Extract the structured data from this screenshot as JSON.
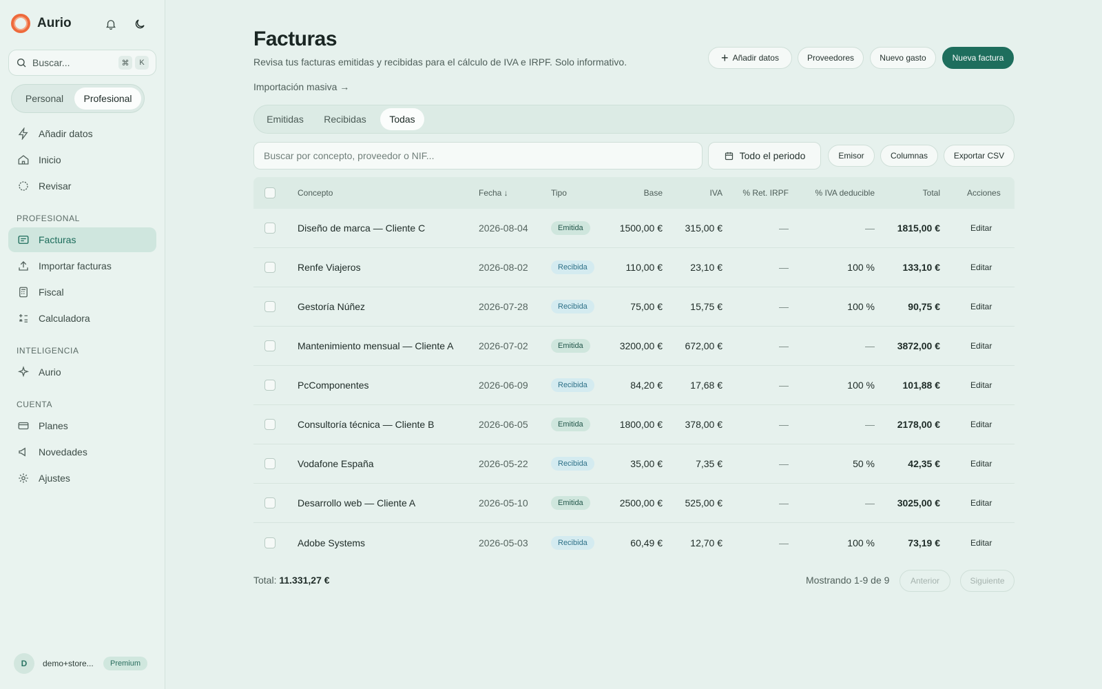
{
  "app": {
    "name": "Aurio"
  },
  "sidebar": {
    "search_placeholder": "Buscar...",
    "kbd_cmd": "⌘",
    "kbd_k": "K",
    "mode_personal": "Personal",
    "mode_profesional": "Profesional",
    "items_top": [
      {
        "label": "Añadir datos",
        "icon": "bolt-icon"
      },
      {
        "label": "Inicio",
        "icon": "home-icon"
      },
      {
        "label": "Revisar",
        "icon": "review-icon"
      }
    ],
    "section_profesional": "PROFESIONAL",
    "items_prof": [
      {
        "label": "Facturas",
        "icon": "invoice-icon",
        "active": true
      },
      {
        "label": "Importar facturas",
        "icon": "upload-icon"
      },
      {
        "label": "Fiscal",
        "icon": "calculator-icon"
      },
      {
        "label": "Calculadora",
        "icon": "math-icon"
      }
    ],
    "section_inteligencia": "INTELIGENCIA",
    "items_int": [
      {
        "label": "Aurio",
        "icon": "sparkle-icon"
      }
    ],
    "section_cuenta": "CUENTA",
    "items_cuenta": [
      {
        "label": "Planes",
        "icon": "card-icon"
      },
      {
        "label": "Novedades",
        "icon": "megaphone-icon"
      },
      {
        "label": "Ajustes",
        "icon": "gear-icon"
      }
    ],
    "user": {
      "initial": "D",
      "name": "demo+store...",
      "plan": "Premium"
    }
  },
  "header": {
    "title": "Facturas",
    "subtitle": "Revisa tus facturas emitidas y recibidas para el cálculo de IVA e IRPF. Solo informativo.",
    "mass_import": "Importación masiva →",
    "btn_add": "Añadir datos",
    "btn_suppliers": "Proveedores",
    "btn_new_expense": "Nuevo gasto",
    "btn_new_invoice": "Nueva factura"
  },
  "tabs": [
    "Emitidas",
    "Recibidas",
    "Todas"
  ],
  "active_tab": "Todas",
  "filters": {
    "search_placeholder": "Buscar por concepto, proveedor o NIF...",
    "period": "Todo el periodo",
    "issuer": "Emisor",
    "columns": "Columnas",
    "export": "Exportar CSV"
  },
  "table": {
    "headers": {
      "concept": "Concepto",
      "date": "Fecha ↓",
      "type": "Tipo",
      "base": "Base",
      "iva": "IVA",
      "irpf": "% Ret. IRPF",
      "iva_ded": "% IVA deducible",
      "total": "Total",
      "actions": "Acciones"
    },
    "edit_label": "Editar",
    "rows": [
      {
        "concept": "Diseño de marca — Cliente C",
        "date": "2026-08-04",
        "type": "Emitida",
        "base": "1500,00 €",
        "iva": "315,00 €",
        "irpf": "—",
        "iva_ded": "—",
        "total": "1815,00 €"
      },
      {
        "concept": "Renfe Viajeros",
        "date": "2026-08-02",
        "type": "Recibida",
        "base": "110,00 €",
        "iva": "23,10 €",
        "irpf": "—",
        "iva_ded": "100 %",
        "total": "133,10 €"
      },
      {
        "concept": "Gestoría Núñez",
        "date": "2026-07-28",
        "type": "Recibida",
        "base": "75,00 €",
        "iva": "15,75 €",
        "irpf": "—",
        "iva_ded": "100 %",
        "total": "90,75 €"
      },
      {
        "concept": "Mantenimiento mensual — Cliente A",
        "date": "2026-07-02",
        "type": "Emitida",
        "base": "3200,00 €",
        "iva": "672,00 €",
        "irpf": "—",
        "iva_ded": "—",
        "total": "3872,00 €"
      },
      {
        "concept": "PcComponentes",
        "date": "2026-06-09",
        "type": "Recibida",
        "base": "84,20 €",
        "iva": "17,68 €",
        "irpf": "—",
        "iva_ded": "100 %",
        "total": "101,88 €"
      },
      {
        "concept": "Consultoría técnica — Cliente B",
        "date": "2026-06-05",
        "type": "Emitida",
        "base": "1800,00 €",
        "iva": "378,00 €",
        "irpf": "—",
        "iva_ded": "—",
        "total": "2178,00 €"
      },
      {
        "concept": "Vodafone España",
        "date": "2026-05-22",
        "type": "Recibida",
        "base": "35,00 €",
        "iva": "7,35 €",
        "irpf": "—",
        "iva_ded": "50 %",
        "total": "42,35 €"
      },
      {
        "concept": "Desarrollo web — Cliente A",
        "date": "2026-05-10",
        "type": "Emitida",
        "base": "2500,00 €",
        "iva": "525,00 €",
        "irpf": "—",
        "iva_ded": "—",
        "total": "3025,00 €"
      },
      {
        "concept": "Adobe Systems",
        "date": "2026-05-03",
        "type": "Recibida",
        "base": "60,49 €",
        "iva": "12,70 €",
        "irpf": "—",
        "iva_ded": "100 %",
        "total": "73,19 €"
      }
    ]
  },
  "footer": {
    "total_label": "Total:",
    "total_value": "11.331,27 €",
    "showing": "Mostrando 1-9 de 9",
    "prev": "Anterior",
    "next": "Siguiente"
  },
  "colors": {
    "accent": "#1e6e5d",
    "background": "#e6f1ed",
    "brand": "#ee6a3c"
  }
}
